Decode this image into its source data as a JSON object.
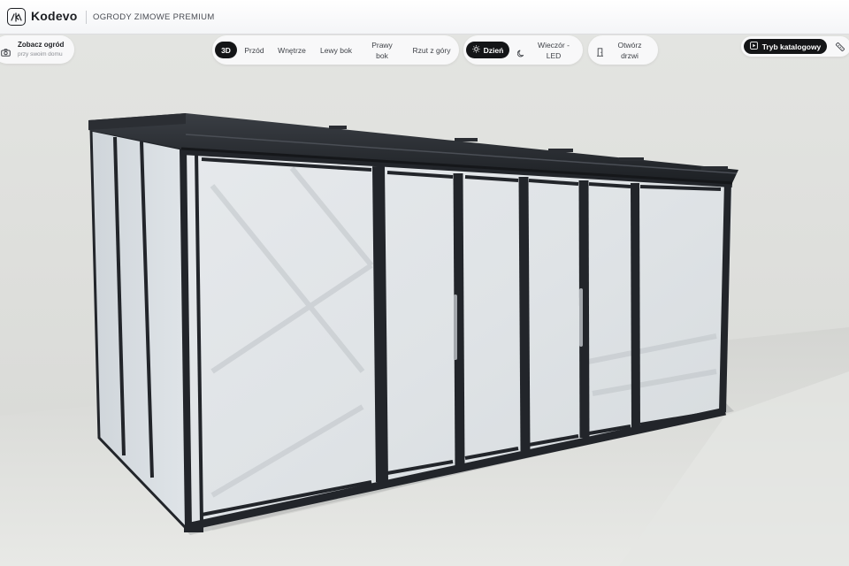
{
  "app": {
    "brand": "Kodevo",
    "subtitle": "OGRODY ZIMOWE PREMIUM"
  },
  "ar_button": {
    "title": "Zobacz ogród",
    "subtitle": "przy swoim domu",
    "icon": "camera-icon"
  },
  "views": {
    "items": [
      {
        "label": "3D",
        "active": true
      },
      {
        "label": "Przód",
        "active": false
      },
      {
        "label": "Wnętrze",
        "active": false
      },
      {
        "label": "Lewy bok",
        "active": false
      },
      {
        "label": "Prawy bok",
        "active": false
      },
      {
        "label": "Rzut z góry",
        "active": false
      }
    ]
  },
  "lighting": {
    "day_label": "Dzień",
    "day_icon": "sun-icon",
    "evening_label": "Wieczór - LED",
    "evening_icon": "moon-icon"
  },
  "doors": {
    "label": "Otwórz drzwi",
    "icon": "door-icon"
  },
  "catalog": {
    "label": "Tryb katalogowy",
    "icon": "catalog-icon",
    "tool_icon": "ruler-icon"
  },
  "colors": {
    "frame": "#22252a",
    "accent_active": "#141517",
    "background": "#e2e3e0"
  }
}
